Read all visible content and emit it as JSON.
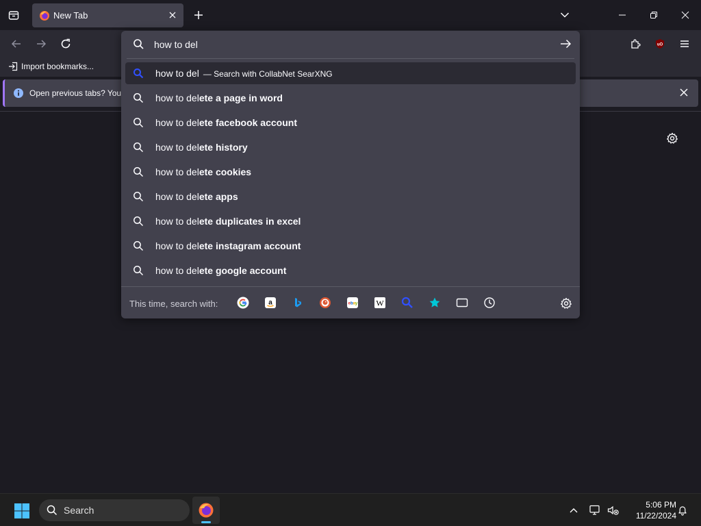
{
  "tab": {
    "title": "New Tab"
  },
  "bookmarks": {
    "import_label": "Import bookmarks..."
  },
  "notification": {
    "text": "Open previous tabs? You c"
  },
  "urlbar": {
    "value": "how to del",
    "selected": {
      "typed": "how to del",
      "action": "— Search with CollabNet SearXNG"
    },
    "suggestions": [
      {
        "typed": "how to del",
        "completion": "ete a page in word"
      },
      {
        "typed": "how to del",
        "completion": "ete facebook account"
      },
      {
        "typed": "how to del",
        "completion": "ete history"
      },
      {
        "typed": "how to del",
        "completion": "ete cookies"
      },
      {
        "typed": "how to del",
        "completion": "ete apps"
      },
      {
        "typed": "how to del",
        "completion": "ete duplicates in excel"
      },
      {
        "typed": "how to del",
        "completion": "ete instagram account"
      },
      {
        "typed": "how to del",
        "completion": "ete google account"
      }
    ],
    "one_off_label": "This time, search with:",
    "engines": [
      "google-icon",
      "amazon-icon",
      "bing-icon",
      "duckduckgo-icon",
      "ebay-icon",
      "wikipedia-icon",
      "searxng-icon",
      "bookmarks-icon",
      "tabs-icon",
      "history-icon"
    ]
  },
  "taskbar": {
    "search_label": "Search",
    "time": "5:06 PM",
    "date": "11/22/2024"
  },
  "colors": {
    "accent": "#a076f8",
    "panel": "#42414d",
    "toolbar": "#2b2a33",
    "background": "#1c1b22",
    "searxng_blue": "#3050ff",
    "bookmark_star": "#00c8d7"
  }
}
